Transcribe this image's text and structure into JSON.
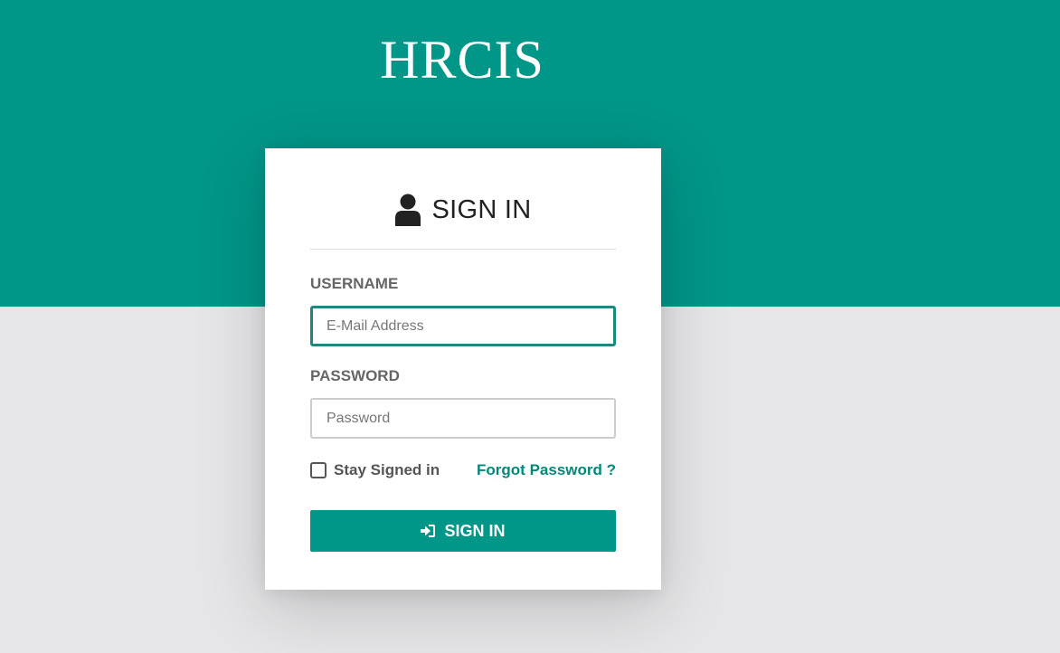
{
  "brand": {
    "title": "HRCIS"
  },
  "login_card": {
    "header_icon": "user-icon",
    "title": "SIGN IN",
    "username": {
      "label": "USERNAME",
      "value": "",
      "placeholder": "E-Mail Address"
    },
    "password": {
      "label": "PASSWORD",
      "value": "",
      "placeholder": "Password"
    },
    "stay_signed_in": {
      "label": "Stay Signed in",
      "checked": false
    },
    "forgot_password": "Forgot Password ?",
    "submit": {
      "icon": "sign-in-icon",
      "label": "SIGN IN"
    }
  },
  "colors": {
    "primary": "#009688",
    "link": "#00897b",
    "background": "#e6e6e8",
    "card": "#ffffff"
  }
}
